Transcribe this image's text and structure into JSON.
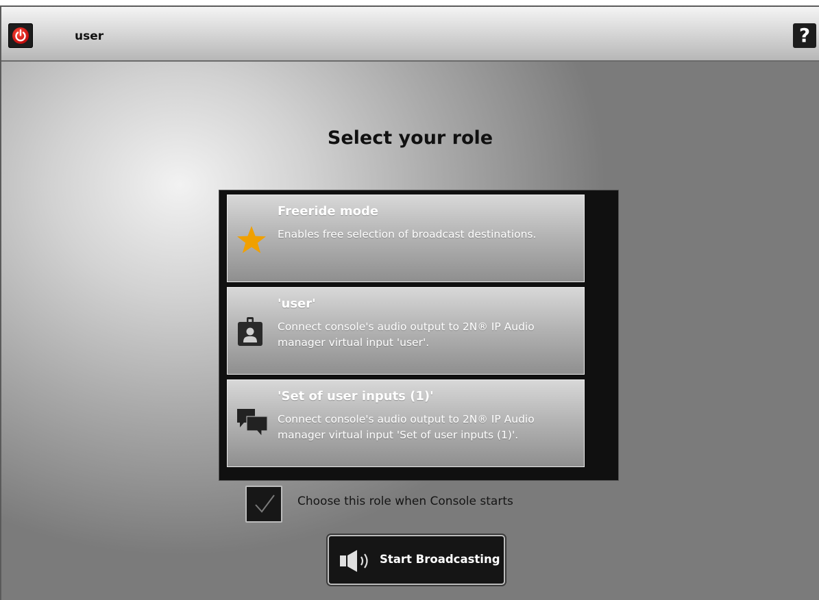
{
  "header": {
    "user_name": "user",
    "help_label": "?"
  },
  "title": "Select your role",
  "roles": [
    {
      "icon": "star-icon",
      "name": "Freeride mode",
      "description": "Enables free selection of broadcast destinations."
    },
    {
      "icon": "user-badge-icon",
      "name": "'user'",
      "description": "Connect console's audio output to 2N® IP Audio manager virtual input 'user'."
    },
    {
      "icon": "chat-bubbles-icon",
      "name": "'Set of user inputs (1)'",
      "description": "Connect console's audio output to 2N® IP Audio manager virtual input 'Set of user inputs (1)'."
    }
  ],
  "remember": {
    "label": "Choose this role when Console starts",
    "checked": true
  },
  "start_button": {
    "label": "Start Broadcasting"
  },
  "colors": {
    "power": "#d81b1b",
    "star": "#f0a000",
    "panel": "#101010"
  }
}
